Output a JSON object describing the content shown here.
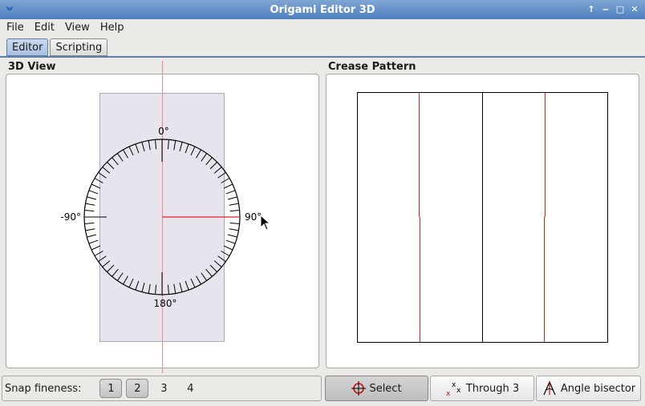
{
  "window": {
    "title": "Origami Editor 3D"
  },
  "menu": [
    "File",
    "Edit",
    "View",
    "Help"
  ],
  "tabs": [
    {
      "label": "Editor",
      "active": true
    },
    {
      "label": "Scripting",
      "active": false
    }
  ],
  "view3d": {
    "title": "3D View",
    "angle_labels": {
      "top": "0°",
      "right": "90°",
      "bottom": "180°",
      "left": "-90°"
    },
    "paper_color": "#e8e4ee",
    "axis_color": "#e02020"
  },
  "crease": {
    "title": "Crease Pattern",
    "line_color": "#e02020"
  },
  "snap": {
    "label": "Snap fineness:",
    "options": [
      {
        "label": "1",
        "pressed": true
      },
      {
        "label": "2",
        "pressed": true
      },
      {
        "label": "3",
        "pressed": false
      },
      {
        "label": "4",
        "pressed": false
      }
    ]
  },
  "tools": [
    {
      "label": "Select",
      "icon": "crosshair-icon",
      "active": true
    },
    {
      "label": "Through 3",
      "icon": "three-points-icon",
      "active": false
    },
    {
      "label": "Angle bisector",
      "icon": "angle-bisector-icon",
      "active": false
    }
  ]
}
